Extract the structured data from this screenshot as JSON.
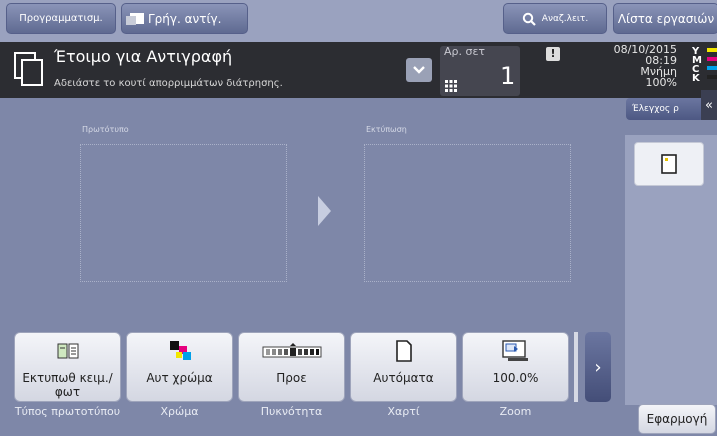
{
  "topbar": {
    "program_label": "Προγραμματισμ.",
    "quick_copy_label": "Γρήγ. αντίγ.",
    "search_label": "Αναζ.λειτ.",
    "job_list_label": "Λίστα εργασιών"
  },
  "status": {
    "title": "Έτοιμο για Αντιγραφή",
    "message": "Αδειάστε το κουτί απορριμμάτων διάτρησης.",
    "copies_label": "Αρ. σετ",
    "copies_value": "1",
    "date": "08/10/2015",
    "time": "08:19",
    "memory_label": "Μνήμη",
    "memory_value": "100%",
    "toner_letters": [
      "Y",
      "M",
      "C",
      "K"
    ],
    "toner_colors": [
      "#f2e600",
      "#e6007e",
      "#00a0e9",
      "#222222"
    ]
  },
  "side": {
    "check_label": "Έλεγχος ρ"
  },
  "preview": {
    "original_label": "Πρωτότυπο",
    "output_label": "Εκτύπωση"
  },
  "functions": [
    {
      "value": "Εκτυπωθ κειμ./φωτ",
      "label": "Τύπος πρωτοτύπου",
      "icon": "book-icon"
    },
    {
      "value": "Αυτ χρώμα",
      "label": "Χρώμα",
      "icon": "color-squares-icon"
    },
    {
      "value": "Προε",
      "label": "Πυκνότητα",
      "icon": "density-scale-icon"
    },
    {
      "value": "Αυτόματα",
      "label": "Χαρτί",
      "icon": "paper-icon"
    },
    {
      "value": "100.0%",
      "label": "Zoom",
      "icon": "zoom-icon"
    }
  ],
  "application_label": "Εφαρμογή"
}
